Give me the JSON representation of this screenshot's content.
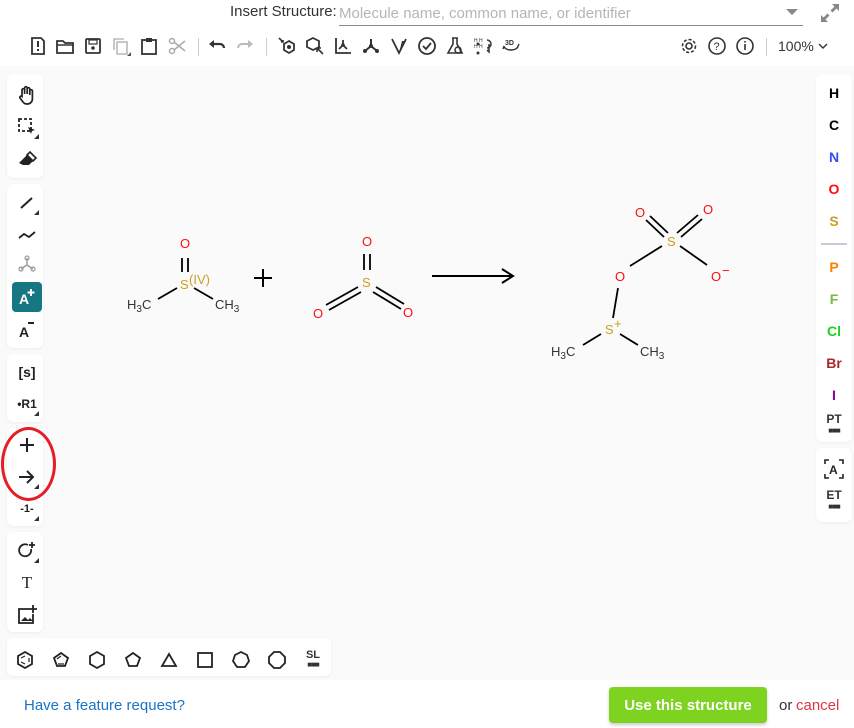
{
  "header": {
    "insert_label": "Insert Structure:",
    "insert_placeholder": "Molecule name, common name, or identifier",
    "insert_value": ""
  },
  "toolbar": {
    "left_icons": [
      "new-file-icon",
      "open-folder-icon",
      "save-icon",
      "copy-icon",
      "paste-icon",
      "cut-icon",
      "undo-icon",
      "redo-icon"
    ],
    "mid_icons": [
      "layout-icon",
      "clean-icon",
      "aromatize-icon",
      "dearomatize-icon",
      "stereo-icon",
      "check-icon",
      "calculate-icon",
      "add-hydrogens-icon",
      "3d-view-icon"
    ],
    "right_icons": [
      "settings-icon",
      "help-icon",
      "about-icon"
    ],
    "zoom_label": "100%"
  },
  "left_tools": {
    "group1": [
      "hand-tool",
      "select-tool",
      "erase-tool"
    ],
    "group2": [
      "bond-tool",
      "chain-tool",
      "template-tool",
      "charge-plus-tool",
      "charge-minus-tool"
    ],
    "group2_labels": {
      "charge_plus": "A",
      "charge_minus": "A"
    },
    "group3": {
      "sgroup": "[s]",
      "rgroup": "R1"
    },
    "group4": [
      "reaction-plus-tool",
      "reaction-arrow-tool",
      "reaction-mapping-tool"
    ],
    "group4_labels": {
      "mapping": "-1-"
    },
    "group5": {
      "shape": "shape-tool",
      "text": "T",
      "image": "image-tool"
    }
  },
  "right_atoms": {
    "basic": [
      {
        "symbol": "H",
        "color": "#000000"
      },
      {
        "symbol": "C",
        "color": "#000000"
      },
      {
        "symbol": "N",
        "color": "#304ff7"
      },
      {
        "symbol": "O",
        "color": "#ff0d0d"
      },
      {
        "symbol": "S",
        "color": "#c9a022"
      }
    ],
    "extra": [
      {
        "symbol": "P",
        "color": "#ff8000"
      },
      {
        "symbol": "F",
        "color": "#78b83a"
      },
      {
        "symbol": "Cl",
        "color": "#1fd01f"
      },
      {
        "symbol": "Br",
        "color": "#a62929"
      },
      {
        "symbol": "I",
        "color": "#940094"
      }
    ],
    "periodic_table": "PT",
    "any_atom": "A",
    "extended_table": "ET"
  },
  "bottom_templates": {
    "items": [
      "benzene",
      "cyclopentadiene",
      "cyclohexane",
      "cyclopentane",
      "cyclopropane",
      "cyclobutane",
      "cycloheptane",
      "cyclooctane"
    ],
    "sl_label": "SL"
  },
  "canvas": {
    "molecule1": {
      "O": "O",
      "S": "S",
      "S_label": "(IV)",
      "left_methyl": "H3C",
      "right_methyl": "CH3"
    },
    "plus": "+",
    "molecule2": {
      "O_top": "O",
      "S": "S",
      "O_left": "O",
      "O_right": "O"
    },
    "product": {
      "O_topleft": "O",
      "O_topright": "O",
      "S_top": "S",
      "O_bridge": "O",
      "O_minus": "O",
      "minus": "−",
      "S_plus": "S",
      "plus": "+",
      "left_methyl": "H3C",
      "right_methyl": "CH3"
    },
    "colors": {
      "oxygen": "#ff0d0d",
      "sulfur": "#c9a022",
      "bond": "#000000"
    }
  },
  "footer": {
    "feature_request": "Have a feature request?",
    "use_button": "Use this structure",
    "or_text": "or",
    "cancel": "cancel"
  }
}
